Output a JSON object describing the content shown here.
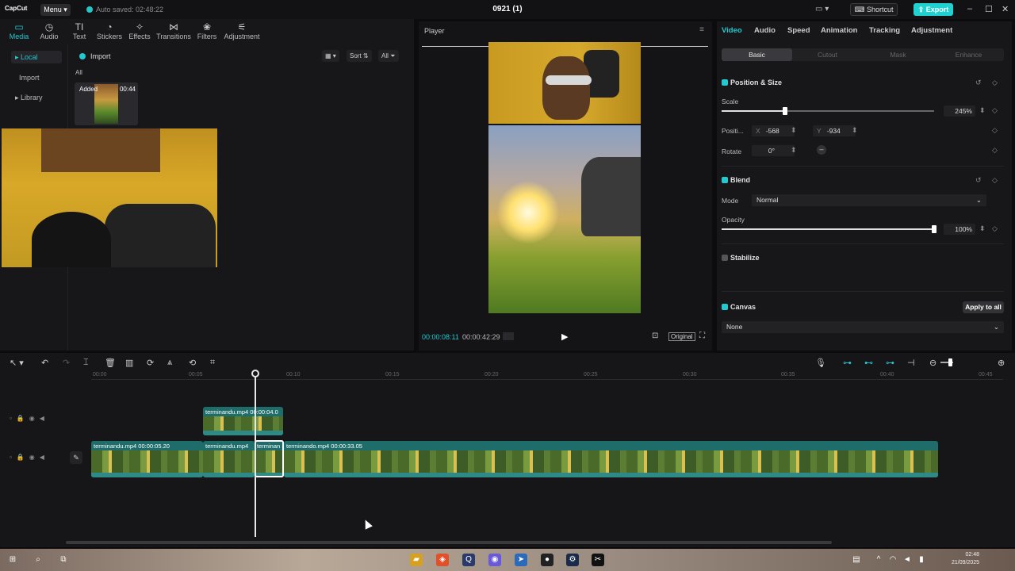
{
  "app": {
    "logo": "CapCut",
    "menu_label": "Menu",
    "autosave": "Auto saved: 02:48:22",
    "project_title": "0921 (1)",
    "shortcut_label": "Shortcut",
    "export_label": "Export"
  },
  "left_tabs": [
    {
      "label": "Media",
      "icon": "media-icon"
    },
    {
      "label": "Audio",
      "icon": "audio-icon"
    },
    {
      "label": "Text",
      "icon": "text-icon"
    },
    {
      "label": "Stickers",
      "icon": "stickers-icon"
    },
    {
      "label": "Effects",
      "icon": "effects-icon"
    },
    {
      "label": "Transitions",
      "icon": "transitions-icon"
    },
    {
      "label": "Filters",
      "icon": "filters-icon"
    },
    {
      "label": "Adjustment",
      "icon": "adjustment-icon"
    }
  ],
  "left_sub": [
    {
      "label": "Local"
    },
    {
      "label": "Import"
    },
    {
      "label": "Library"
    }
  ],
  "media": {
    "import_label": "Import",
    "sort_label": "Sort",
    "all_filter": "All",
    "all_heading": "All",
    "thumb_badge": "Added",
    "thumb_duration": "00:44"
  },
  "player": {
    "title": "Player",
    "current_time": "00:00:08:11",
    "total_time": "00:00:42:29",
    "original_label": "Original"
  },
  "right_tabs": [
    "Video",
    "Audio",
    "Speed",
    "Animation",
    "Tracking",
    "Adjustment"
  ],
  "right_subtabs": [
    "Basic",
    "Cutout",
    "Mask",
    "Enhance"
  ],
  "position_size": {
    "title": "Position & Size",
    "scale_label": "Scale",
    "scale_value": "245%",
    "scale_fraction": 0.3,
    "position_label": "Positi...",
    "x_label": "X",
    "x_value": "-568",
    "y_label": "Y",
    "y_value": "-934",
    "rotate_label": "Rotate",
    "rotate_value": "0°"
  },
  "blend": {
    "title": "Blend",
    "mode_label": "Mode",
    "mode_value": "Normal",
    "opacity_label": "Opacity",
    "opacity_value": "100%",
    "opacity_fraction": 1.0
  },
  "stabilize": {
    "title": "Stabilize"
  },
  "canvas": {
    "title": "Canvas",
    "apply_label": "Apply to all",
    "value": "None"
  },
  "timeline": {
    "ruler": [
      "00:00",
      "00:05",
      "00:10",
      "00:15",
      "00:20",
      "00:25",
      "00:30",
      "00:35",
      "00:40",
      "00:45"
    ],
    "clips": [
      {
        "label": "terminandu.mp4",
        "duration": "00:00:04.0"
      },
      {
        "label": "terminandu.mp4",
        "duration": "00:00:05.20"
      },
      {
        "label": "terminandu.mp4",
        "duration": ""
      },
      {
        "label": "terminan",
        "duration": ""
      },
      {
        "label": "terminando.mp4",
        "duration": "00:00:33.05"
      }
    ]
  },
  "taskbar": {
    "time": "02:48",
    "date": "21/09/2025"
  }
}
